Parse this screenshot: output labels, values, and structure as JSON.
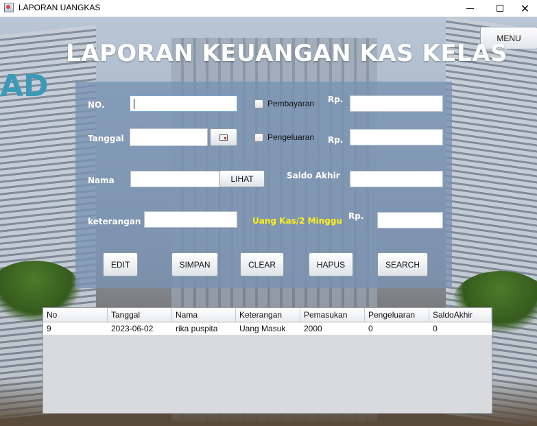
{
  "window": {
    "title": "LAPORAN UANGKAS",
    "controls": {
      "minimize": "minimize-icon",
      "maximize": "maximize-icon",
      "close": "close-icon"
    }
  },
  "menu_button": "MENU",
  "page_title": "LAPORAN KEUANGAN KAS KELAS",
  "form": {
    "no_label": "NO.",
    "no_value": "",
    "tanggal_label": "Tanggal",
    "tanggal_value": "",
    "nama_label": "Nama",
    "nama_value": "",
    "lihat_button": "LIHAT",
    "keterangan_label": "keterangan",
    "keterangan_value": "",
    "pembayaran_label": "Pembayaran",
    "pembayaran_checked": false,
    "pengeluaran_label": "Pengeluaran",
    "pengeluaran_checked": false,
    "rp1_label": "Rp.",
    "rp1_value": "",
    "rp2_label": "Rp.",
    "rp2_value": "",
    "saldo_label": "Saldo Akhir",
    "saldo_value": "",
    "uangkas_label": "Uang Kas/2 Minggu",
    "rp3_label": "Rp.",
    "rp3_value": ""
  },
  "actions": {
    "edit": "EDIT",
    "simpan": "SIMPAN",
    "clear": "CLEAR",
    "hapus": "HAPUS",
    "search": "SEARCH"
  },
  "table": {
    "columns": [
      "No",
      "Tanggal",
      "Nama",
      "Keterangan",
      "Pemasukan",
      "Pengeluaran",
      "SaldoAkhir"
    ],
    "rows": [
      [
        "9",
        "2023-06-02",
        "rika puspita",
        "Uang Masuk",
        "2000",
        "0",
        "0"
      ]
    ]
  },
  "colors": {
    "panel": "#7892b2",
    "highlight_label": "#ffee1a",
    "title_text": "#ffffff"
  }
}
